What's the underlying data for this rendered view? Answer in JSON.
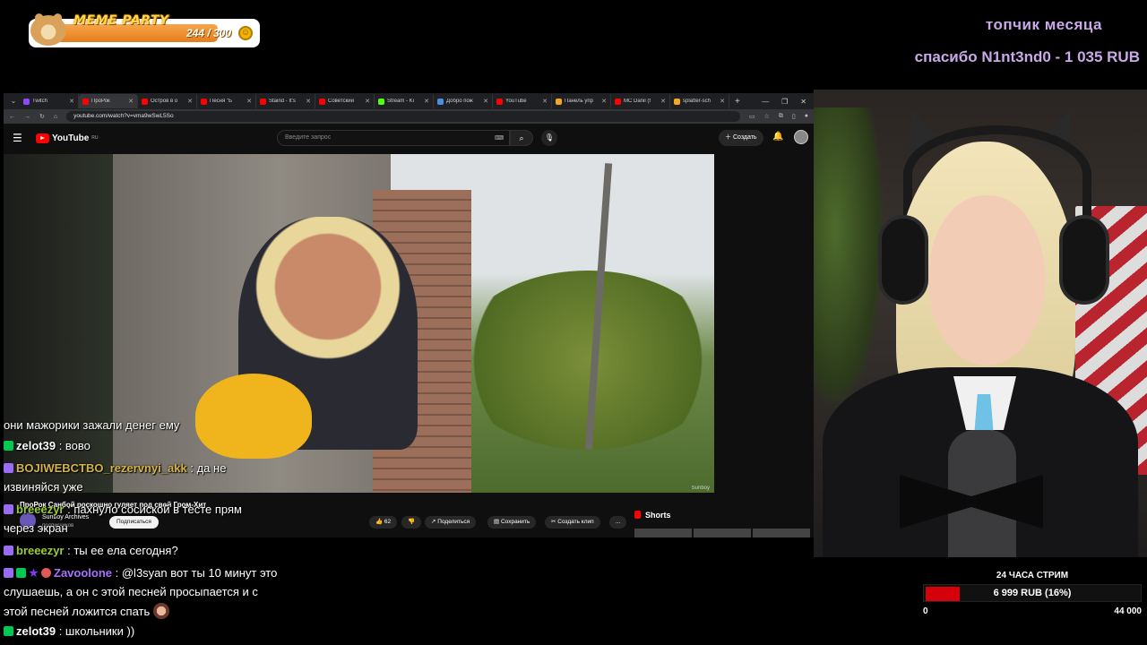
{
  "meme_party": {
    "title": "MEME PARTY",
    "current": 244,
    "max": 300,
    "count_text": "244 / 300"
  },
  "top_donor": {
    "label": "топчик месяца",
    "thanks": "спасибо N1nt3nd0 - 1 035 RUB"
  },
  "browser": {
    "tabs": [
      {
        "label": "Twitch",
        "color": "#9146ff",
        "active": false
      },
      {
        "label": "ПроРок",
        "color": "#ff0000",
        "active": true
      },
      {
        "label": "Остров в о",
        "color": "#ff0000",
        "active": false
      },
      {
        "label": "Песня \"Б",
        "color": "#ff0000",
        "active": false
      },
      {
        "label": "Staind - It's",
        "color": "#ff0000",
        "active": false
      },
      {
        "label": "Советский",
        "color": "#ff0000",
        "active": false
      },
      {
        "label": "Stream - Ki",
        "color": "#53fc18",
        "active": false
      },
      {
        "label": "Добро пож",
        "color": "#4a90e2",
        "active": false
      },
      {
        "label": "YouTube",
        "color": "#ff0000",
        "active": false
      },
      {
        "label": "Панель упр",
        "color": "#f5a623",
        "active": false
      },
      {
        "label": "MC Danil (f",
        "color": "#ff0000",
        "active": false
      },
      {
        "label": "splatter-sch",
        "color": "#f5a623",
        "active": false
      }
    ],
    "url": "youtube.com/watch?v=vma9wSwL5So"
  },
  "youtube": {
    "logo_text": "YouTube",
    "logo_region": "RU",
    "search_placeholder": "Введите запрос",
    "create_label": "Создать",
    "video_title": "ПроРок Санбой роскошно гуляет под свой Гром-Хит",
    "channel_name": "Sunboy Archives",
    "channel_subs": "подписчиков",
    "subscribe_label": "Подписаться",
    "likes": "62",
    "share_label": "Поделиться",
    "save_label": "Сохранить",
    "clip_label": "Создать клип",
    "more_label": "...",
    "shorts_label": "Shorts",
    "video_watermark": "Sunboy"
  },
  "chat": [
    {
      "badges": [],
      "user": "",
      "user_color": "#ffffff",
      "text": "они мажорики зажали денег ему"
    },
    {
      "badges": [
        "green"
      ],
      "user": "zelot39",
      "user_color": "#ffffff",
      "text": ": вово"
    },
    {
      "badges": [
        "purple"
      ],
      "user": "BOJIWEBCTBO_rezervnyi_akk",
      "user_color": "#d4b348",
      "text": ": да не"
    },
    {
      "badges": [],
      "user": "",
      "user_color": "#ffffff",
      "text": "извиняйся уже"
    },
    {
      "badges": [
        "purple"
      ],
      "user": "breeezyr",
      "user_color": "#9acd32",
      "text": ": пахнуло сосиской в тесте прям"
    },
    {
      "badges": [],
      "user": "",
      "user_color": "#ffffff",
      "text": "через экран"
    },
    {
      "badges": [
        "purple"
      ],
      "user": "breeezyr",
      "user_color": "#9acd32",
      "text": ": ты ее ела сегодня?"
    },
    {
      "badges": [
        "purple",
        "green",
        "star",
        "heart"
      ],
      "user": "Zavoolone",
      "user_color": "#a970ff",
      "text": ": @l3syan вот ты 10 минут это"
    },
    {
      "badges": [],
      "user": "",
      "user_color": "#ffffff",
      "text": "слушаешь, а он с этой песней просыпается и с"
    },
    {
      "badges": [],
      "user": "",
      "user_color": "#ffffff",
      "text": "этой песней ложится спать"
    },
    {
      "badges": [
        "green"
      ],
      "user": "zelot39",
      "user_color": "#ffffff",
      "text": ": школьники  ))"
    }
  ],
  "subathon": {
    "title": "24 ЧАСА СТРИМ",
    "amount_text": "6 999 RUB (16%)",
    "progress_percent": 16,
    "min_label": "0",
    "max_label": "44 000",
    "bar_color": "#d4000a"
  }
}
